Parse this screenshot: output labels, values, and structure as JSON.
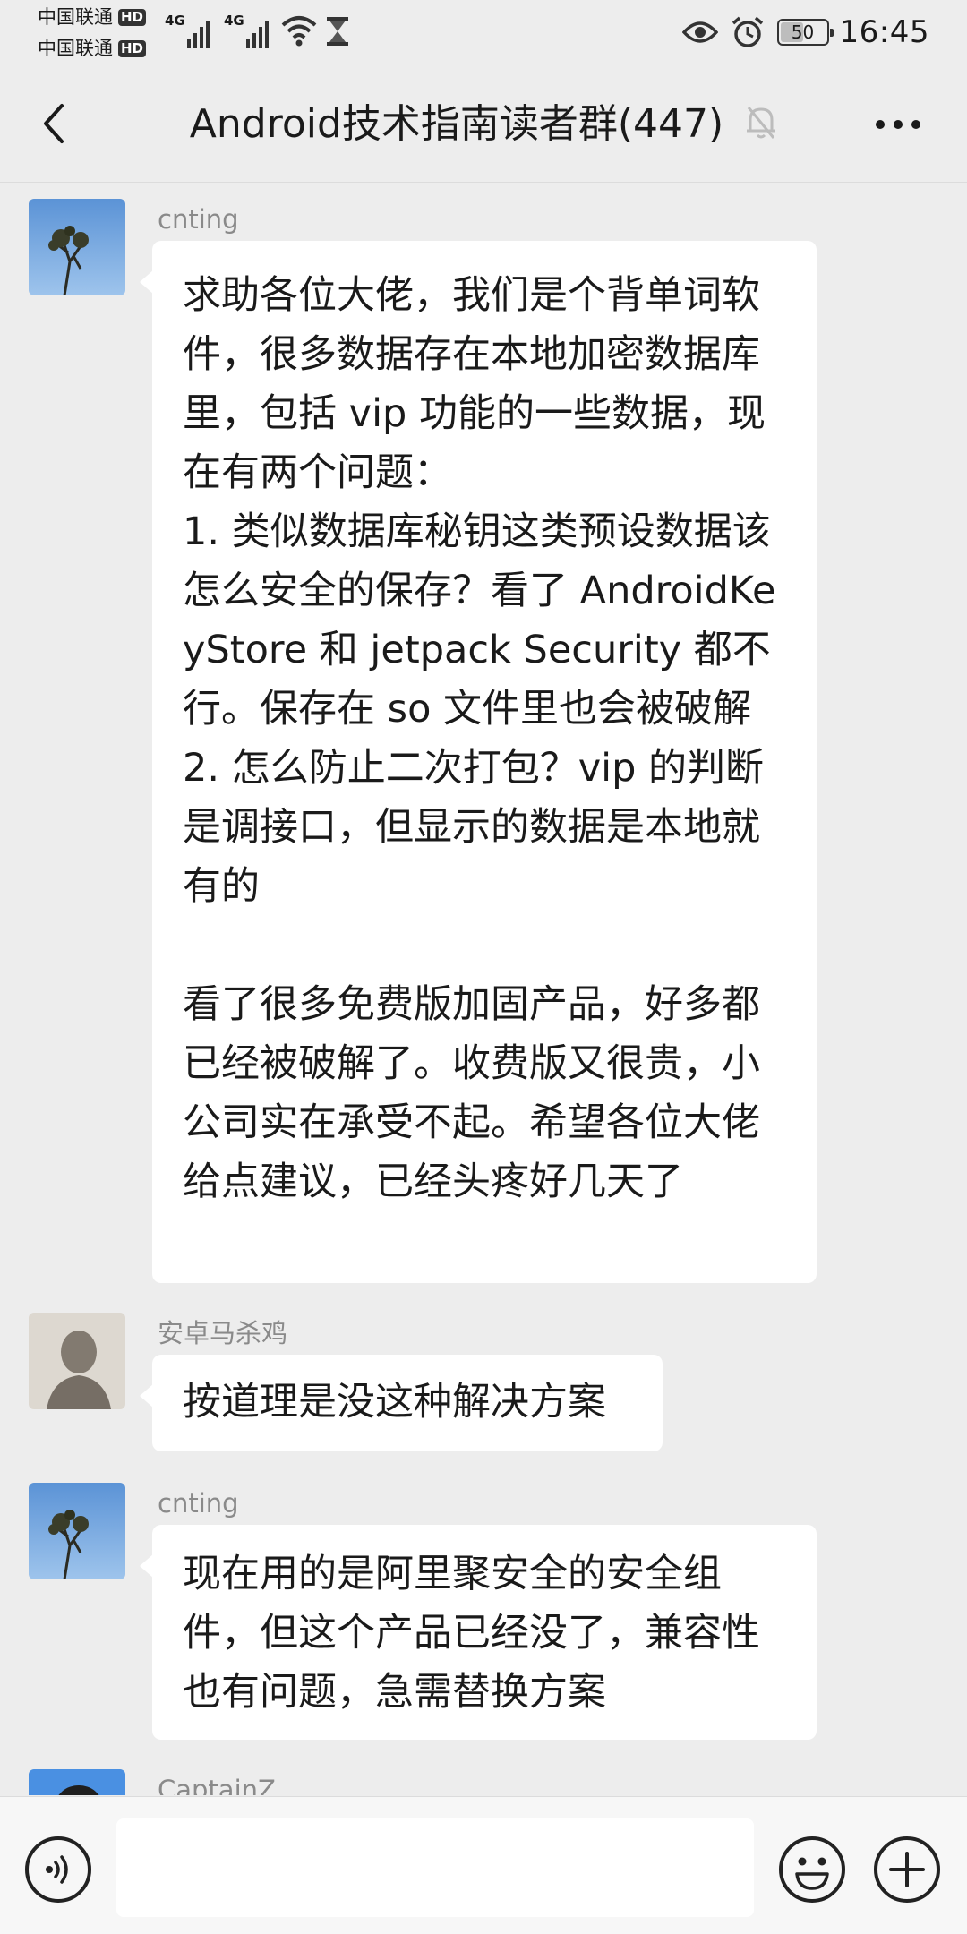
{
  "status_bar": {
    "carrier_1": "中国联通",
    "carrier_2": "中国联通",
    "hd_badge": "HD",
    "network_type": "4G",
    "battery": "50",
    "battery_level": 0.5,
    "time": "16:45",
    "icons": [
      "signal-icon",
      "wifi-icon",
      "hourglass-icon",
      "eye-icon",
      "alarm-icon",
      "battery-icon"
    ]
  },
  "header": {
    "title": "Android技术指南读者群(447)",
    "icons": [
      "back-arrow-icon",
      "mute-bell-icon",
      "more-dots-icon"
    ]
  },
  "messages": [
    {
      "sender": "cnting",
      "avatar": "tree-sky-avatar",
      "text": "求助各位大佬，我们是个背单词软件，很多数据存在本地加密数据库里，包括 vip 功能的一些数据，现在有两个问题：\n1. 类似数据库秘钥这类预设数据该怎么安全的保存？看了 AndroidKeyStore 和 jetpack Security 都不行。保存在 so 文件里也会被破解\n2. 怎么防止二次打包？vip 的判断是调接口，但显示的数据是本地就有的\n\n看了很多免费版加固产品，好多都已经被破解了。收费版又很贵，小公司实在承受不起。希望各位大佬给点建议，已经头疼好几天了"
    },
    {
      "sender": "安卓马杀鸡",
      "avatar": "silhouette-avatar",
      "text": "按道理是没这种解决方案"
    },
    {
      "sender": "cnting",
      "avatar": "tree-sky-avatar",
      "text": "现在用的是阿里聚安全的安全组件，但这个产品已经没了，兼容性也有问题，急需替换方案"
    },
    {
      "sender": "CaptainZ",
      "avatar": "dark-hair-avatar",
      "text": ""
    }
  ],
  "input_bar": {
    "value": "",
    "icons": [
      "voice-icon",
      "emoji-icon",
      "plus-icon"
    ]
  }
}
